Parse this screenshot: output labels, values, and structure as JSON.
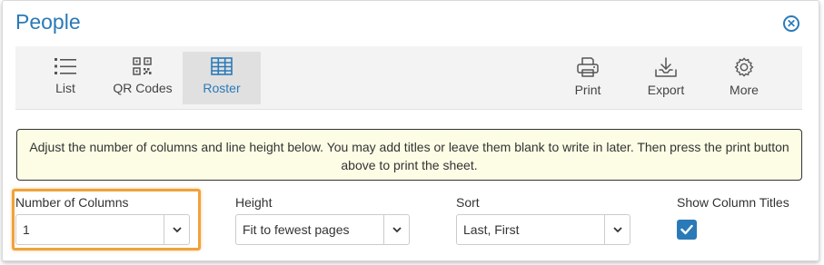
{
  "header": {
    "title": "People",
    "close_icon": "close-circle-icon"
  },
  "toolbar": {
    "left": [
      {
        "label": "List",
        "icon": "list-icon",
        "active": false
      },
      {
        "label": "QR Codes",
        "icon": "qr-code-icon",
        "active": false
      },
      {
        "label": "Roster",
        "icon": "table-grid-icon",
        "active": true
      }
    ],
    "right": [
      {
        "label": "Print",
        "icon": "printer-icon"
      },
      {
        "label": "Export",
        "icon": "download-tray-icon"
      },
      {
        "label": "More",
        "icon": "gear-icon"
      }
    ]
  },
  "notice": {
    "text": "Adjust the number of columns and line height below. You may add titles or leave them blank to write in later. Then press the print button above to print the sheet."
  },
  "form": {
    "columns": {
      "label": "Number of Columns",
      "value": "1"
    },
    "height": {
      "label": "Height",
      "value": "Fit to fewest pages"
    },
    "sort": {
      "label": "Sort",
      "value": "Last, First"
    },
    "show_titles": {
      "label": "Show Column Titles",
      "checked": true
    }
  },
  "colors": {
    "accent": "#2a7ab8",
    "highlight": "#f0a23a",
    "notice_bg": "#fdfde6"
  }
}
